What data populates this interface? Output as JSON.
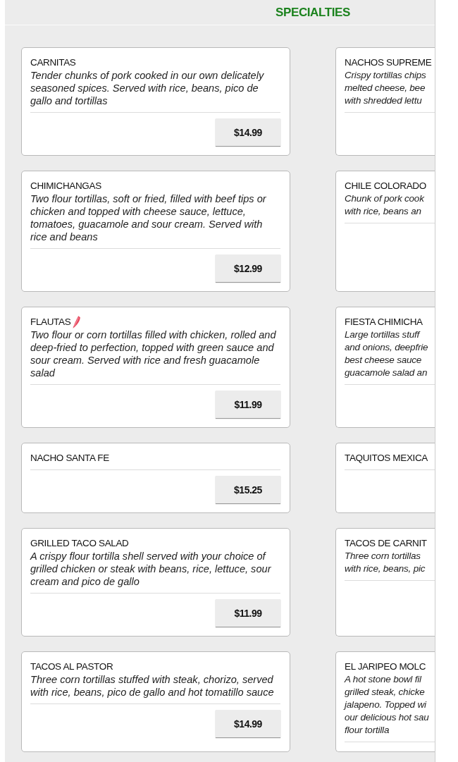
{
  "header": {
    "title": "SPECIALTIES"
  },
  "menu_items": [
    {
      "name": "CARNITAS",
      "spicy": false,
      "description": "Tender chunks of pork cooked in our own delicately seasoned spices. Served with rice, beans, pico de gallo and tortillas",
      "price": "$14.99"
    },
    {
      "name": "NACHOS SUPREME",
      "spicy": false,
      "description_lines": [
        "Crispy tortillas chips",
        "melted cheese, bee",
        "with shredded lettu"
      ]
    },
    {
      "name": "CHIMICHANGAS",
      "spicy": false,
      "description": "Two flour tortillas, soft or fried, filled with beef tips or chicken and topped with cheese sauce, lettuce, tomatoes, guacamole and sour cream. Served with rice and beans",
      "price": "$12.99"
    },
    {
      "name": "CHILE COLORADO",
      "spicy": false,
      "description_lines": [
        "Chunk of pork cook",
        "with rice, beans an"
      ]
    },
    {
      "name": "FLAUTAS",
      "spicy": true,
      "description": "Two flour or corn tortillas filled with chicken, rolled and deep-fried to perfection, topped with green sauce and sour cream. Served with rice and fresh guacamole salad",
      "price": "$11.99"
    },
    {
      "name": "FIESTA CHIMICHA",
      "spicy": false,
      "description_lines": [
        "Large tortillas stuff",
        "and onions, deepfrie",
        "best cheese sauce",
        "guacamole salad an"
      ]
    },
    {
      "name": "NACHO SANTA FE",
      "spicy": false,
      "price": "$15.25"
    },
    {
      "name": "TAQUITOS MEXICA",
      "spicy": false
    },
    {
      "name": "GRILLED TACO SALAD",
      "spicy": false,
      "description": "A crispy flour tortilla shell served with your choice of grilled chicken or steak with beans, rice, lettuce, sour cream and pico de gallo",
      "price": "$11.99"
    },
    {
      "name": "TACOS DE CARNIT",
      "spicy": false,
      "description_lines": [
        "Three corn tortillas",
        "with rice, beans, pic"
      ]
    },
    {
      "name": "TACOS AL PASTOR",
      "spicy": false,
      "description": "Three corn tortillas stuffed with steak, chorizo, served with rice, beans, pico de gallo and hot tomatillo sauce",
      "price": "$14.99"
    },
    {
      "name": "EL JARIPEO MOLC",
      "spicy": false,
      "description_lines": [
        "A hot stone bowl fil",
        "grilled steak, chicke",
        "jalapeno. Topped wi",
        "our delicious hot sau",
        "flour tortilla"
      ]
    }
  ]
}
